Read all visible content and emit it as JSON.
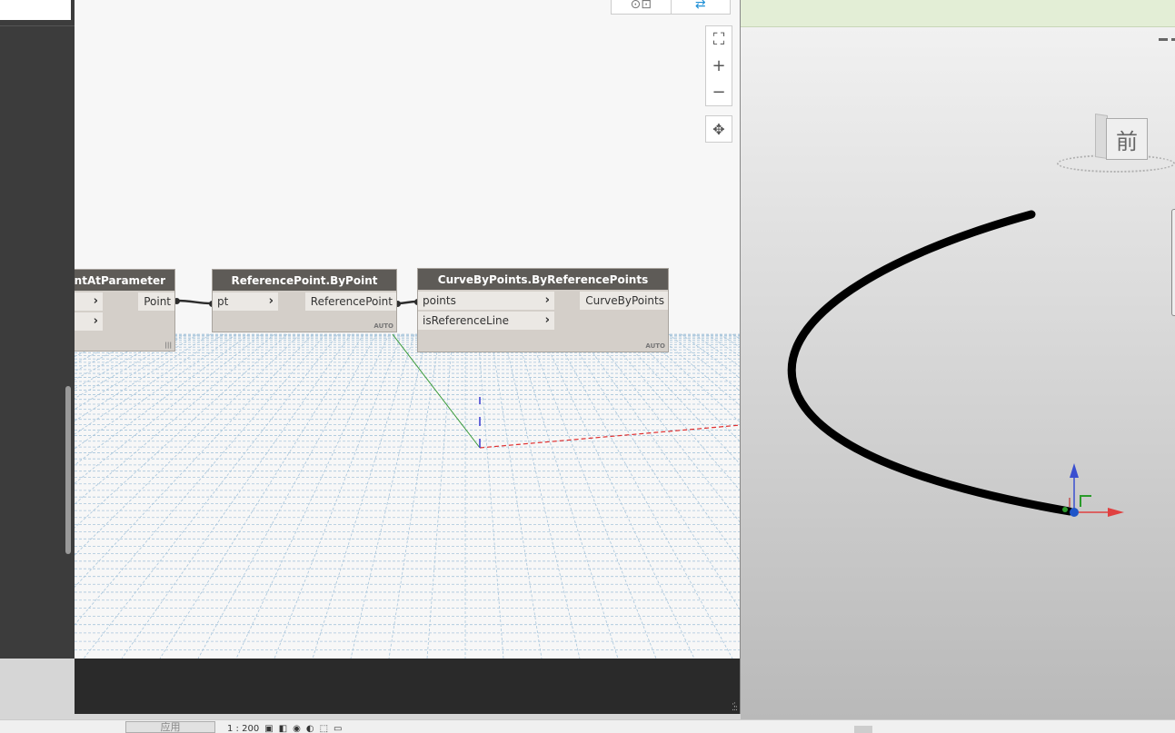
{
  "dynamo": {
    "view_toggle": {
      "graph_icon": "graph-view-icon",
      "background_icon": "background-preview-icon"
    },
    "zoom": {
      "fit": "⛶",
      "zoom_in": "+",
      "zoom_out": "−",
      "pan": "✥"
    },
    "nodes": {
      "point_at_parameter": {
        "title": "ointAtParameter",
        "output": "Point",
        "footer": "|||"
      },
      "reference_point": {
        "title": "ReferencePoint.ByPoint",
        "input": "pt",
        "output": "ReferencePoint",
        "footer": "AUTO"
      },
      "curve_by_points": {
        "title": "CurveByPoints.ByReferencePoints",
        "inputs": [
          "points",
          "isReferenceLine"
        ],
        "output": "CurveByPoints",
        "footer": "AUTO"
      }
    }
  },
  "revit": {
    "viewcube_label": "前",
    "colors": {
      "curve": "#000000",
      "axis_x": "#e04040",
      "axis_y": "#2a9a2a",
      "axis_z": "#3a4fd0"
    }
  },
  "footer": {
    "apply_label": "应用",
    "scale_text": "1 : 200"
  }
}
